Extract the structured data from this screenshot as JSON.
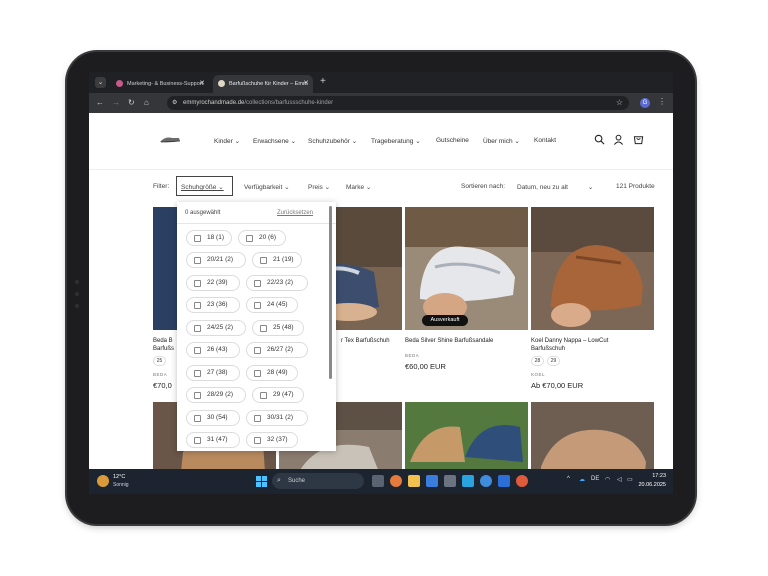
{
  "browser": {
    "tabs": [
      {
        "title": "Marketing- & Business-Support",
        "active": false
      },
      {
        "title": "Barfußschuhe für Kinder – Emm",
        "active": true
      }
    ],
    "new_tab_label": "+",
    "url_host": "emmyrochandmade.de",
    "url_path": "/collections/barfussschuhe-kinder",
    "profile_initial": "G"
  },
  "site": {
    "nav": [
      "Kinder",
      "Erwachsene",
      "Schuhzubehör",
      "Trageberatung",
      "Gutscheine",
      "Über mich",
      "Kontakt"
    ],
    "filter": {
      "label": "Filter:",
      "options": [
        "Schuhgröße",
        "Verfügbarkeit",
        "Preis",
        "Marke"
      ],
      "sort_label": "Sortieren nach:",
      "sort_value": "Datum, neu zu alt",
      "count": "121 Produkte"
    },
    "dropdown": {
      "selected": "0 ausgewählt",
      "reset": "Zurücksetzen",
      "sizes": [
        "18 (1)",
        "20 (6)",
        "20/21 (2)",
        "21 (19)",
        "22 (39)",
        "22/23 (2)",
        "23 (36)",
        "24 (45)",
        "24/25 (2)",
        "25 (48)",
        "26 (43)",
        "26/27 (2)",
        "27 (38)",
        "28 (49)",
        "28/29 (2)",
        "29 (47)",
        "30 (54)",
        "30/31 (2)",
        "31 (47)",
        "32 (37)"
      ]
    },
    "products": [
      {
        "title_line1": "Beda B",
        "title_line2": "Barfußs",
        "brand": "BEDA",
        "price": "€70,0",
        "sizes": [
          "25"
        ]
      },
      {
        "title_line1": "r Tex Barfußschuh",
        "title_line2": "",
        "brand": "",
        "price": "",
        "sizes": []
      },
      {
        "title_line1": "Beda Silver Shine Barfußsandale",
        "title_line2": "",
        "brand": "BEDA",
        "price": "€60,00 EUR",
        "sizes": [],
        "badge": "Ausverkauft"
      },
      {
        "title_line1": "Koel Danny Nappa – LowCut",
        "title_line2": "Barfußschuh",
        "brand": "KOEL",
        "price": "Ab €70,00 EUR",
        "sizes": [
          "28",
          "29"
        ]
      }
    ]
  },
  "taskbar": {
    "weather_temp": "12°C",
    "weather_cond": "Sonnig",
    "search_placeholder": "Suche",
    "tray_lang": "DE",
    "time": "17:23",
    "date": "20.06.2025"
  },
  "colors": {
    "browser_dark": "#202124",
    "taskbar": "#1c2430",
    "tablet_bezel": "#1d1d1f"
  }
}
